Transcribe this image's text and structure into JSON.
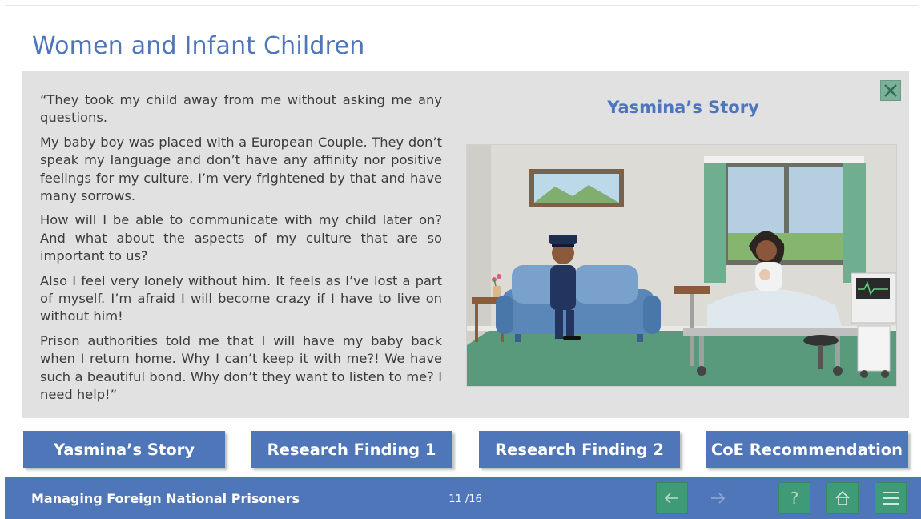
{
  "page": {
    "title": "Women and Infant Children"
  },
  "story": {
    "heading": "Yasmina’s Story",
    "paragraphs": [
      "“They took my child away from me without asking me any questions.",
      "My baby boy was placed with a European Couple. They don’t speak my language and don’t have any affinity nor positive feelings for my culture. I’m very frightened by that and have many sorrows.",
      "How will I be able to communicate with my child later on? And what about the aspects of my culture that are so important to us?",
      "Also I feel very lonely without him. It feels as I’ve lost a part of myself. I’m afraid I will become crazy if I have to live on without him!",
      "Prison authorities told me that I will have my baby back when I return home. Why I can’t keep it with me?! We have such a beautiful bond. Why don’t they want to listen to me? I need help!”"
    ]
  },
  "tabs": [
    {
      "label": "Yasmina’s Story"
    },
    {
      "label": "Research Finding 1"
    },
    {
      "label": "Research Finding 2"
    },
    {
      "label": "CoE Recommendation"
    }
  ],
  "footer": {
    "course_title": "Managing Foreign National Prisoners",
    "page_counter": "11 /16",
    "buttons": {
      "prev": "arrow-left-icon",
      "next": "arrow-right-icon",
      "help": "?",
      "home": "home-icon",
      "menu": "menu-icon"
    }
  },
  "colors": {
    "accent_blue": "#4f76b9",
    "panel_gray": "#e1e1e1",
    "nav_green": "#3f9a78",
    "close_green": "#7eaf98"
  }
}
